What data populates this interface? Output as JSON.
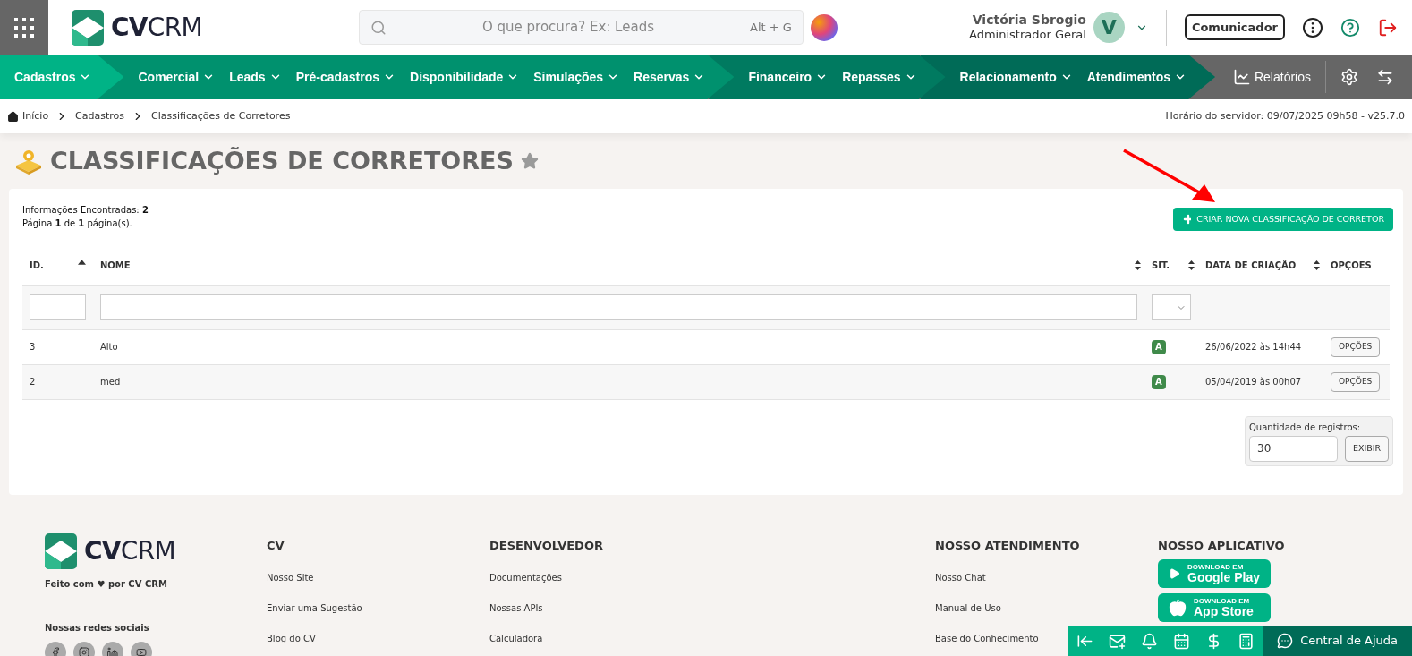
{
  "header": {
    "logo": {
      "bold": "CV",
      "light": "CRM"
    },
    "search": {
      "placeholder": "O que procura? Ex: Leads",
      "shortcut": "Alt + G"
    },
    "user": {
      "name": "Victória Sbrogio",
      "role": "Administrador Geral",
      "initial": "V"
    },
    "communicator": "Comunicador"
  },
  "nav": {
    "groups": [
      {
        "color": "#00b386",
        "items": [
          "Cadastros"
        ]
      },
      {
        "color": "#00916e",
        "items": [
          "Comercial",
          "Leads",
          "Pré-cadastros",
          "Disponibilidade",
          "Simulações",
          "Reservas"
        ]
      },
      {
        "color": "#007a60",
        "items": [
          "Financeiro",
          "Repasses"
        ]
      },
      {
        "color": "#006b57",
        "items": [
          "Relacionamento",
          "Atendimentos"
        ]
      }
    ],
    "reports": "Relatórios"
  },
  "breadcrumb": [
    "Início",
    "Cadastros",
    "Classificações de Corretores"
  ],
  "server_time": "Horário do servidor: 09/07/2025 09h58 - v25.7.0",
  "page_title": "CLASSIFICAÇÕES DE CORRETORES",
  "summary": [
    "Informações Encontradas: **2**",
    "Página **1** de **1** página(s)."
  ],
  "create_button": "CRIAR NOVA CLASSIFICAÇÃO DE CORRETOR",
  "table": {
    "columns": [
      {
        "label": "ID.",
        "sortable": true,
        "sorted_ascending": true
      },
      {
        "label": "NOME",
        "sortable": true,
        "sorted_ascending": false
      },
      {
        "label": "SIT.",
        "sortable": true,
        "sorted_ascending": false
      },
      {
        "label": "DATA DE CRIAÇÃO",
        "sortable": true,
        "sorted_ascending": false
      },
      {
        "label": "OPÇÕES"
      }
    ],
    "rows": [
      {
        "id": "3",
        "name": "Alto",
        "status": "A",
        "created": "26/06/2022 às 14h44",
        "options": "OPÇÕES"
      },
      {
        "id": "2",
        "name": "med",
        "status": "A",
        "created": "05/04/2019 às 00h07",
        "options": "OPÇÕES"
      }
    ]
  },
  "page_size": {
    "label": "Quantidade de registros:",
    "value": "30",
    "button": "EXIBIR"
  },
  "footer": {
    "logo": {
      "bold": "CV",
      "light": "CRM"
    },
    "tagline": "Feito com ♥ por CV CRM",
    "social_title": "Nossas redes sociais",
    "columns": [
      {
        "title": "CV",
        "links": [
          "Nosso Site",
          "Enviar uma Sugestão",
          "Blog do CV"
        ]
      },
      {
        "title": "DESENVOLVEDOR",
        "links": [
          "Documentações",
          "Nossas APIs",
          "Calculadora"
        ]
      },
      {
        "title": "NOSSO ATENDIMENTO",
        "links": [
          "Nosso Chat",
          "Manual de Uso",
          "Base do Conhecimento"
        ]
      }
    ],
    "app_title": "NOSSO APLICATIVO",
    "stores": [
      {
        "kind": "google",
        "small": "DOWNLOAD EM",
        "big": "Google Play"
      },
      {
        "kind": "apple",
        "small": "DOWNLOAD EM",
        "big": "App Store"
      }
    ]
  },
  "help": "Central de Ajuda"
}
